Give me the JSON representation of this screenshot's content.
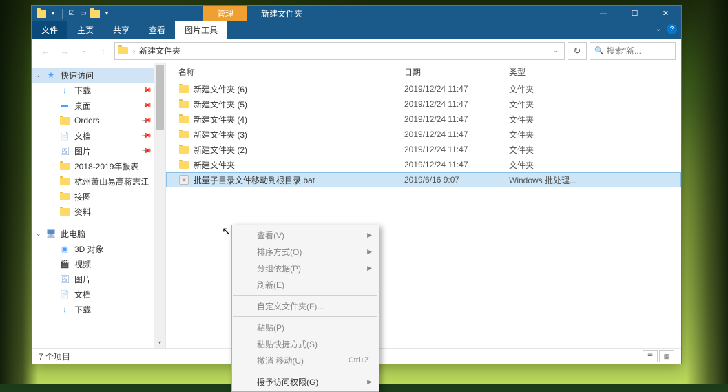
{
  "titlebar": {
    "context_tab": "管理",
    "title": "新建文件夹"
  },
  "ribbon": {
    "file": "文件",
    "tabs": [
      "主页",
      "共享",
      "查看"
    ],
    "ctx_tab": "图片工具"
  },
  "address": {
    "segment": "新建文件夹"
  },
  "search": {
    "placeholder": "搜索\"新..."
  },
  "sidebar": {
    "quick": "快速访问",
    "items": [
      {
        "label": "下载",
        "icon": "dl",
        "pin": true
      },
      {
        "label": "桌面",
        "icon": "desk",
        "pin": true
      },
      {
        "label": "Orders",
        "icon": "fold",
        "pin": true
      },
      {
        "label": "文档",
        "icon": "doc",
        "pin": true
      },
      {
        "label": "图片",
        "icon": "pic",
        "pin": true
      },
      {
        "label": "2018-2019年报表",
        "icon": "fold",
        "pin": false
      },
      {
        "label": "杭州萧山易高蒋志江",
        "icon": "fold",
        "pin": false
      },
      {
        "label": "接图",
        "icon": "fold",
        "pin": false
      },
      {
        "label": "资料",
        "icon": "fold",
        "pin": false
      }
    ],
    "pc": "此电脑",
    "pc_items": [
      {
        "label": "3D 对象",
        "icon": "3d"
      },
      {
        "label": "视频",
        "icon": "vid"
      },
      {
        "label": "图片",
        "icon": "pic"
      },
      {
        "label": "文档",
        "icon": "doc"
      },
      {
        "label": "下载",
        "icon": "dl"
      }
    ]
  },
  "columns": {
    "name": "名称",
    "date": "日期",
    "type": "类型"
  },
  "files": [
    {
      "name": "新建文件夹 (6)",
      "date": "2019/12/24 11:47",
      "type": "文件夹",
      "kind": "folder"
    },
    {
      "name": "新建文件夹 (5)",
      "date": "2019/12/24 11:47",
      "type": "文件夹",
      "kind": "folder"
    },
    {
      "name": "新建文件夹 (4)",
      "date": "2019/12/24 11:47",
      "type": "文件夹",
      "kind": "folder"
    },
    {
      "name": "新建文件夹 (3)",
      "date": "2019/12/24 11:47",
      "type": "文件夹",
      "kind": "folder"
    },
    {
      "name": "新建文件夹 (2)",
      "date": "2019/12/24 11:47",
      "type": "文件夹",
      "kind": "folder"
    },
    {
      "name": "新建文件夹",
      "date": "2019/12/24 11:47",
      "type": "文件夹",
      "kind": "folder"
    },
    {
      "name": "批量子目录文件移动到根目录.bat",
      "date": "2019/6/16 9:07",
      "type": "Windows 批处理...",
      "kind": "bat",
      "selected": true
    }
  ],
  "status": {
    "count": "7 个项目"
  },
  "context": {
    "items": [
      {
        "label": "查看(V)",
        "sub": true,
        "enabled": false
      },
      {
        "label": "排序方式(O)",
        "sub": true,
        "enabled": false
      },
      {
        "label": "分组依据(P)",
        "sub": true,
        "enabled": false
      },
      {
        "label": "刷新(E)",
        "enabled": false
      },
      {
        "sep": true
      },
      {
        "label": "自定义文件夹(F)...",
        "enabled": false
      },
      {
        "sep": true
      },
      {
        "label": "粘贴(P)",
        "enabled": false
      },
      {
        "label": "粘贴快捷方式(S)",
        "enabled": false
      },
      {
        "label": "撤消 移动(U)",
        "shortcut": "Ctrl+Z",
        "enabled": false
      },
      {
        "sep": true
      },
      {
        "label": "授予访问权限(G)",
        "sub": true,
        "enabled": true
      }
    ]
  }
}
